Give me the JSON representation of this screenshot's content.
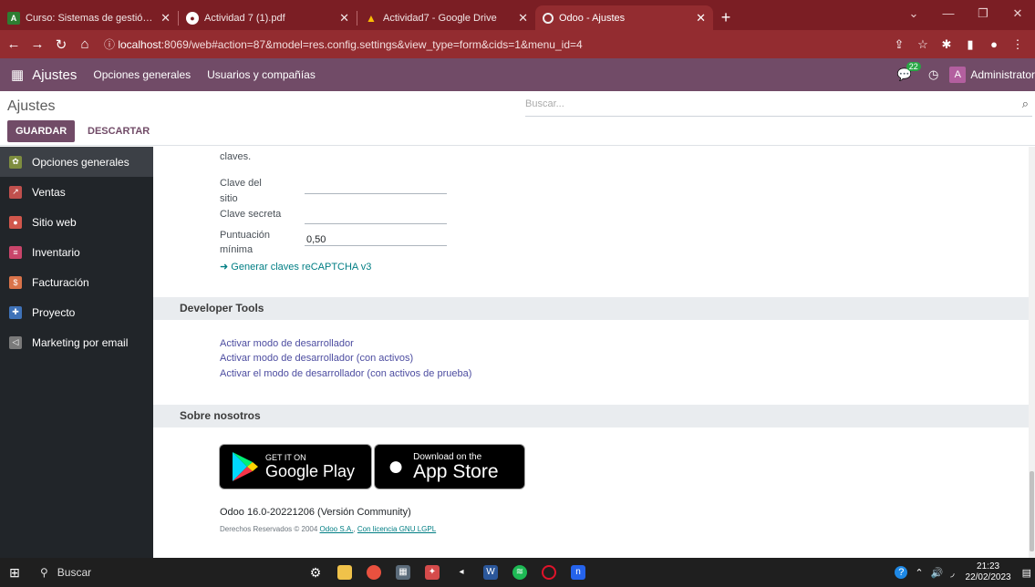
{
  "browser": {
    "tabs": [
      {
        "label": "Curso: Sistemas de gestión empr",
        "icon": "a-tab-icon",
        "color": "#2e7d32"
      },
      {
        "label": "Actividad 7 (1).pdf",
        "icon": "globe-icon",
        "color": "#ffffff"
      },
      {
        "label": "Actividad7 - Google Drive",
        "icon": "drive-icon",
        "color": "#fbbc04"
      },
      {
        "label": "Odoo - Ajustes",
        "icon": "odoo-icon",
        "color": "#f0f0f0"
      }
    ],
    "url_host": "localhost",
    "url_rest": ":8069/web#action=87&model=res.config.settings&view_type=form&cids=1&menu_id=4"
  },
  "navbar": {
    "app_title": "Ajustes",
    "menu": [
      "Opciones generales",
      "Usuarios y compañías"
    ],
    "chat_count": "22",
    "avatar_letter": "A",
    "user_name": "Administrator"
  },
  "control_panel": {
    "title": "Ajustes",
    "search_placeholder": "Buscar...",
    "save_label": "GUARDAR",
    "discard_label": "DESCARTAR"
  },
  "sidebar": {
    "items": [
      {
        "label": "Opciones generales",
        "color": "#7e8d3f"
      },
      {
        "label": "Ventas",
        "color": "#c0504d"
      },
      {
        "label": "Sitio web",
        "color": "#d1574c"
      },
      {
        "label": "Inventario",
        "color": "#c9456a"
      },
      {
        "label": "Facturación",
        "color": "#d9734a"
      },
      {
        "label": "Proyecto",
        "color": "#3f72b8"
      },
      {
        "label": "Marketing por email",
        "color": "#7a7a7a"
      }
    ]
  },
  "main": {
    "claves_text": "claves.",
    "site_key_label_1": "Clave del",
    "site_key_label_2": "sitio",
    "secret_key_label": "Clave secreta",
    "min_score_label_1": "Puntuación",
    "min_score_label_2": "mínima",
    "min_score_value": "0,50",
    "recaptcha_link": "Generar claves reCAPTCHA v3",
    "developer_section": "Developer Tools",
    "dev_links": [
      "Activar modo de desarrollador",
      "Activar modo de desarrollador (con activos)",
      "Activar el modo de desarrollador (con activos de prueba)"
    ],
    "about_section": "Sobre nosotros",
    "google_play_small": "GET IT ON",
    "google_play_big": "Google Play",
    "app_store_small": "Download on the",
    "app_store_big": "App Store",
    "version": "Odoo 16.0-20221206 (Versión Community)",
    "copyright_prefix": "Derechos Reservados © 2004",
    "company_link": "Odoo S.A.",
    "license_link": "Con licencia GNU LGPL"
  },
  "taskbar": {
    "search_label": "Buscar",
    "time": "21:23",
    "date": "22/02/2023"
  }
}
